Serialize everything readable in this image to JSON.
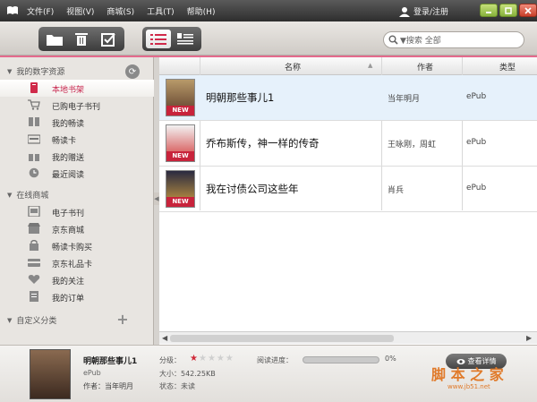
{
  "menu": [
    "文件(F)",
    "视图(V)",
    "商城(S)",
    "工具(T)",
    "帮助(H)"
  ],
  "login": "登录/注册",
  "search": {
    "placeholder": "▼搜索 全部"
  },
  "sidebar": {
    "my_resources": "我的数字资源",
    "items_1": [
      "本地书架",
      "已购电子书刊",
      "我的畅读",
      "畅读卡",
      "我的赠送",
      "最近阅读"
    ],
    "online_store": "在线商城",
    "items_2": [
      "电子书刊",
      "京东商城",
      "畅读卡购买",
      "京东礼品卡",
      "我的关注",
      "我的订单"
    ],
    "custom": "自定义分类"
  },
  "table": {
    "headers": [
      "名称",
      "作者",
      "类型"
    ],
    "rows": [
      {
        "title": "明朝那些事儿1",
        "author": "当年明月",
        "type": "ePub",
        "badge": "NEW"
      },
      {
        "title": "乔布斯传，神一样的传奇",
        "author": "王咏刚，周虹",
        "type": "ePub",
        "badge": "NEW"
      },
      {
        "title": "我在讨债公司这些年",
        "author": "肖兵",
        "type": "ePub",
        "badge": "NEW"
      }
    ]
  },
  "detail": {
    "title": "明朝那些事儿1",
    "format": "ePub",
    "author": "作者：当年明月",
    "rating_label": "分级：",
    "rating": 1,
    "size": "大小：542.25KB",
    "status": "状态：未读",
    "progress_label": "阅读进度：",
    "progress": 0,
    "progress_text": "0%",
    "button": "查看详情"
  },
  "watermark": {
    "text": "脚 本 之 家",
    "url": "www.jb51.net"
  },
  "colors": {
    "accent": "#e46a8d",
    "active_text": "#c8274f",
    "new_badge": "#c8233b"
  }
}
